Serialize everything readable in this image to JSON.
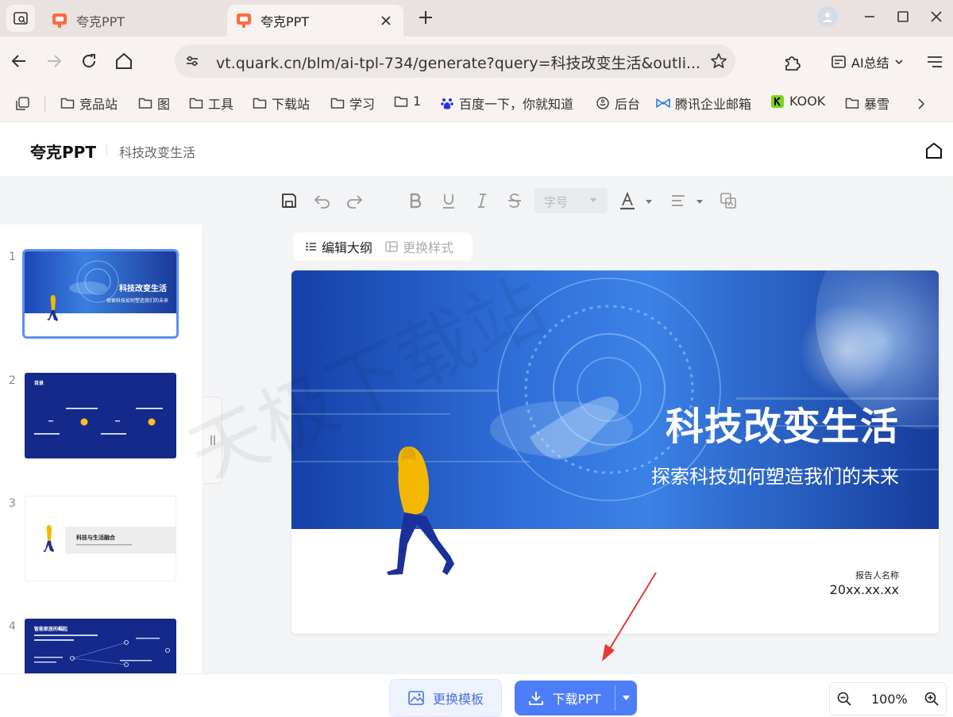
{
  "browser": {
    "tabs": [
      {
        "title": "夸克PPT",
        "active": false
      },
      {
        "title": "夸克PPT",
        "active": true
      }
    ],
    "url": "vt.quark.cn/blm/ai-tpl-734/generate?query=科技改变生活&outli...",
    "ai_summary_label": "AI总结",
    "bookmarks": [
      {
        "label": "竞品站",
        "icon": "folder-icon"
      },
      {
        "label": "图",
        "icon": "folder-icon"
      },
      {
        "label": "工具",
        "icon": "folder-icon"
      },
      {
        "label": "下载站",
        "icon": "folder-icon"
      },
      {
        "label": "学习",
        "icon": "folder-icon"
      },
      {
        "label": "1",
        "icon": "folder-icon"
      },
      {
        "label": "百度一下，你就知道",
        "icon": "baidu-icon"
      },
      {
        "label": "后台",
        "icon": "backend-icon"
      },
      {
        "label": "腾讯企业邮箱",
        "icon": "tencent-mail-icon"
      },
      {
        "label": "KOOK",
        "icon": "kook-icon"
      },
      {
        "label": "暴雪",
        "icon": "folder-icon"
      }
    ]
  },
  "app": {
    "title": "夸克PPT",
    "doc_name": "科技改变生活"
  },
  "toolbar": {
    "font_size_placeholder": "字号"
  },
  "editor_tabs": {
    "outline": "编辑大纲",
    "style": "更换样式"
  },
  "thumbnails": [
    {
      "num": "1",
      "title": "科技改变生活",
      "subtitle": "探索科技如何塑造我们的未来"
    },
    {
      "num": "2",
      "heading": "目录"
    },
    {
      "num": "3",
      "heading": "科技与生活融合"
    },
    {
      "num": "4",
      "heading": "智能家居的崛起"
    }
  ],
  "slide": {
    "title": "科技改变生活",
    "subtitle": "探索科技如何塑造我们的未来",
    "reporter_label": "报告人名称",
    "date": "20xx.xx.xx"
  },
  "bottom": {
    "change_template": "更换模板",
    "download": "下载PPT",
    "zoom": "100%"
  },
  "colors": {
    "accent": "#4d7ef7",
    "slide_blue": "#1a3fa8",
    "figure_yellow": "#f5b800"
  }
}
